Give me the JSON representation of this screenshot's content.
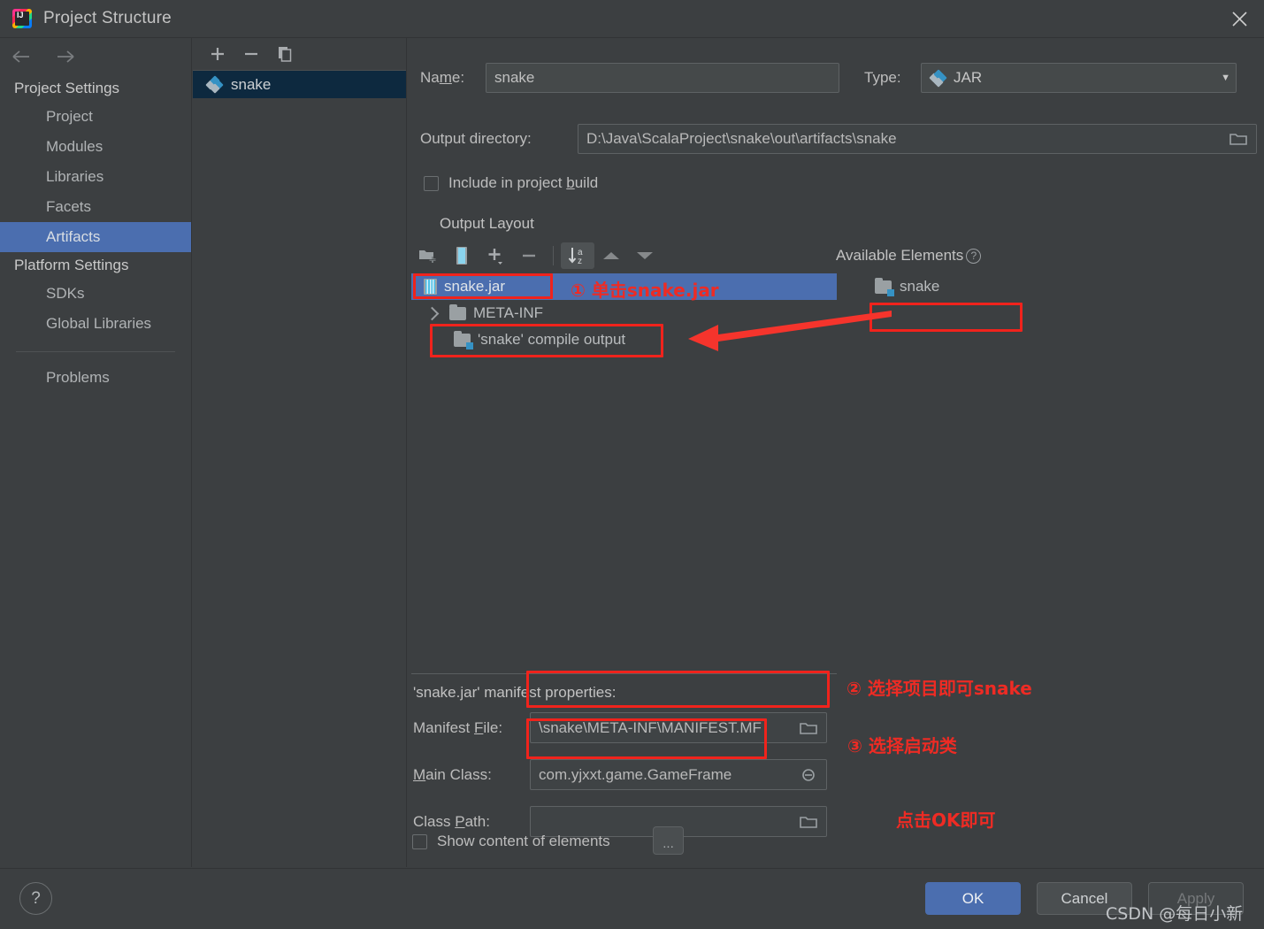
{
  "window": {
    "title": "Project Structure",
    "logo_text": "IJ",
    "close_icon": "close-icon"
  },
  "nav": {
    "back_icon": "arrow-left-icon",
    "forward_icon": "arrow-right-icon",
    "sections": [
      {
        "label": "Project Settings",
        "type": "group"
      },
      {
        "label": "Project",
        "type": "item",
        "selected": false
      },
      {
        "label": "Modules",
        "type": "item",
        "selected": false
      },
      {
        "label": "Libraries",
        "type": "item",
        "selected": false
      },
      {
        "label": "Facets",
        "type": "item",
        "selected": false
      },
      {
        "label": "Artifacts",
        "type": "item",
        "selected": true
      },
      {
        "label": "Platform Settings",
        "type": "group"
      },
      {
        "label": "SDKs",
        "type": "item",
        "selected": false
      },
      {
        "label": "Global Libraries",
        "type": "item",
        "selected": false
      },
      {
        "label": "Problems",
        "type": "item",
        "selected": false
      }
    ]
  },
  "artifacts_panel": {
    "toolbar": [
      {
        "name": "add-artifact-button",
        "glyph": "+"
      },
      {
        "name": "remove-artifact-button",
        "glyph": "−"
      },
      {
        "name": "copy-artifact-button",
        "glyph": "copy-icon"
      }
    ],
    "items": [
      {
        "label": "snake",
        "icon": "artifact-diamond-icon",
        "selected": true
      }
    ]
  },
  "form": {
    "name_label": "Name:",
    "name_value": "snake",
    "type_label": "Type:",
    "type_value": "JAR",
    "type_caret": "▼",
    "output_dir_label": "Output directory:",
    "output_dir_value": "D:\\Java\\ScalaProject\\snake\\out\\artifacts\\snake",
    "include_in_build_label": "Include in project build",
    "include_in_build_checked": false,
    "output_layout_label": "Output Layout"
  },
  "layout_toolbar": [
    {
      "name": "create-directory-button",
      "icon": "folder-add-icon"
    },
    {
      "name": "create-archive-button",
      "icon": "jar-archive-icon"
    },
    {
      "name": "add-copy-of-button",
      "icon": "plus-dropdown-icon"
    },
    {
      "name": "remove-element-button",
      "icon": "minus-icon"
    },
    {
      "name": "sort-by-name-button",
      "icon": "sort-az-icon",
      "active": true
    },
    {
      "name": "move-up-button",
      "icon": "triangle-up-icon"
    },
    {
      "name": "move-down-button",
      "icon": "triangle-down-icon"
    }
  ],
  "output_tree": [
    {
      "label": "snake.jar",
      "icon": "jar-archive-icon",
      "depth": 0,
      "selected": true,
      "expandable": false
    },
    {
      "label": "META-INF",
      "icon": "folder-icon",
      "depth": 1,
      "selected": false,
      "expandable": true
    },
    {
      "label": "'snake' compile output",
      "icon": "module-output-icon",
      "depth": 1,
      "selected": false,
      "expandable": false
    }
  ],
  "available_elements": {
    "title": "Available Elements",
    "help_icon": "help-circle-icon",
    "help_glyph": "?",
    "items": [
      {
        "label": "snake",
        "icon": "module-output-icon"
      }
    ]
  },
  "manifest": {
    "section_title": "'snake.jar' manifest properties:",
    "manifest_file_label": "Manifest File:",
    "manifest_file_value": "\\snake\\META-INF\\MANIFEST.MF",
    "main_class_label": "Main Class:",
    "main_class_value": "com.yjxxt.game.GameFrame",
    "class_path_label": "Class Path:",
    "class_path_value": "",
    "browse_icon": "folder-browse-icon",
    "show_content_label": "Show content of elements",
    "show_content_checked": false,
    "dots_button_label": "..."
  },
  "footer": {
    "help_label": "?",
    "ok_label": "OK",
    "cancel_label": "Cancel",
    "apply_label": "Apply"
  },
  "annotations": {
    "step1": "① 单击snake.jar",
    "step2": "② 选择项目即可snake",
    "step3": "③ 选择启动类",
    "step4": "点击OK即可",
    "color": "#ee2b24"
  },
  "watermark": "CSDN @每日小新"
}
